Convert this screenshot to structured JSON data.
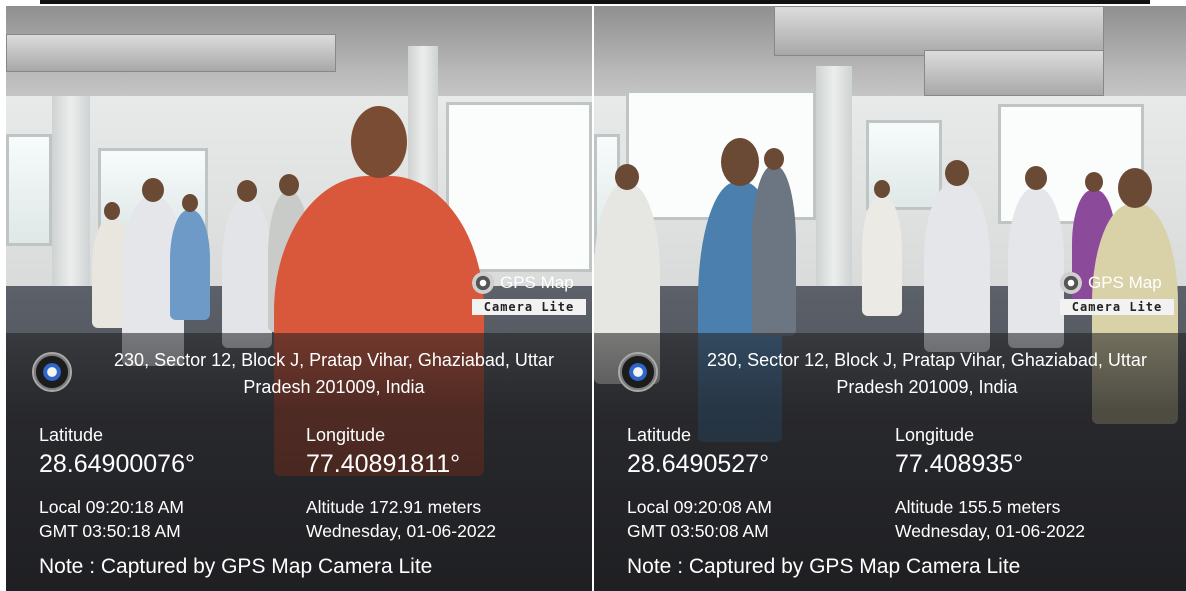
{
  "photos": [
    {
      "badge_title": "GPS Map",
      "badge_sub": "Camera Lite",
      "address_line1": "230, Sector 12, Block J, Pratap Vihar, Ghaziabad, Uttar",
      "address_line2": "Pradesh 201009, India",
      "latitude_label": "Latitude",
      "latitude_value": "28.64900076°",
      "longitude_label": "Longitude",
      "longitude_value": "77.40891811°",
      "local_time": "Local 09:20:18 AM",
      "gmt_time": "GMT 03:50:18 AM",
      "altitude": "Altitude 172.91 meters",
      "date": "Wednesday, 01-06-2022",
      "note": "Note : Captured by GPS Map Camera Lite"
    },
    {
      "badge_title": "GPS Map",
      "badge_sub": "Camera Lite",
      "address_line1": "230, Sector 12, Block J, Pratap Vihar, Ghaziabad, Uttar",
      "address_line2": "Pradesh 201009, India",
      "latitude_label": "Latitude",
      "latitude_value": "28.6490527°",
      "longitude_label": "Longitude",
      "longitude_value": "77.408935°",
      "local_time": "Local 09:20:08 AM",
      "gmt_time": "GMT 03:50:08 AM",
      "altitude": "Altitude 155.5 meters",
      "date": "Wednesday, 01-06-2022",
      "note": "Note : Captured by GPS Map Camera Lite"
    }
  ],
  "icons": {
    "badge": "camera-lens-icon",
    "compass": "compass-icon"
  },
  "colors": {
    "overlay": "#1e1e20",
    "text": "#ffffff",
    "floor": "#45474e",
    "wall": "#e3e5e5"
  }
}
